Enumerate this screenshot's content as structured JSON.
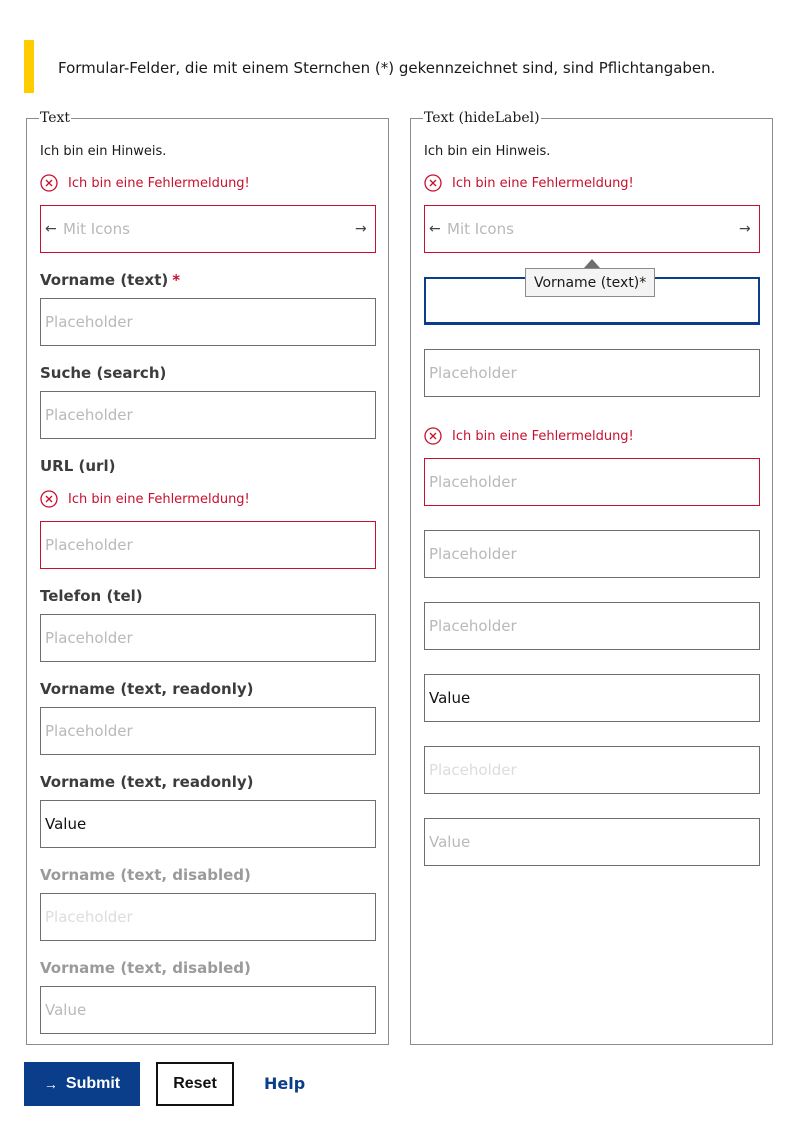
{
  "notice": {
    "text": "Formular-Felder, die mit einem Sternchen (*) gekennzeichnet sind, sind Pflichtangaben.",
    "accent": "#ffcc00"
  },
  "colors": {
    "error": "#c8102e",
    "primary": "#0a3e8a"
  },
  "left": {
    "legend": "Text",
    "hint": "Ich bin ein Hinweis.",
    "error": "Ich bin eine Fehlermeldung!",
    "icons_placeholder": "Mit Icons",
    "vorname_label": "Vorname (text)",
    "required_mark": "*",
    "vorname_placeholder": "Placeholder",
    "suche_label": "Suche (search)",
    "suche_placeholder": "Placeholder",
    "url_label": "URL (url)",
    "url_error": "Ich bin eine Fehlermeldung!",
    "url_placeholder": "Placeholder",
    "tel_label": "Telefon (tel)",
    "tel_placeholder": "Placeholder",
    "ro1_label": "Vorname (text, readonly)",
    "ro1_placeholder": "Placeholder",
    "ro2_label": "Vorname (text, readonly)",
    "ro2_value": "Value",
    "dis1_label": "Vorname (text, disabled)",
    "dis1_placeholder": "Placeholder",
    "dis2_label": "Vorname (text, disabled)",
    "dis2_value": "Value"
  },
  "right": {
    "legend": "Text (hideLabel)",
    "hint": "Ich bin ein Hinweis.",
    "error": "Ich bin eine Fehlermeldung!",
    "icons_placeholder": "Mit Icons",
    "tooltip": "Vorname (text)*",
    "f2_placeholder": "Placeholder",
    "url_error": "Ich bin eine Fehlermeldung!",
    "f3_placeholder": "Placeholder",
    "f4_placeholder": "Placeholder",
    "f5_placeholder": "Placeholder",
    "f6_value": "Value",
    "f7_placeholder": "Placeholder",
    "f8_value": "Value"
  },
  "actions": {
    "submit": "Submit",
    "reset": "Reset",
    "help": "Help"
  }
}
